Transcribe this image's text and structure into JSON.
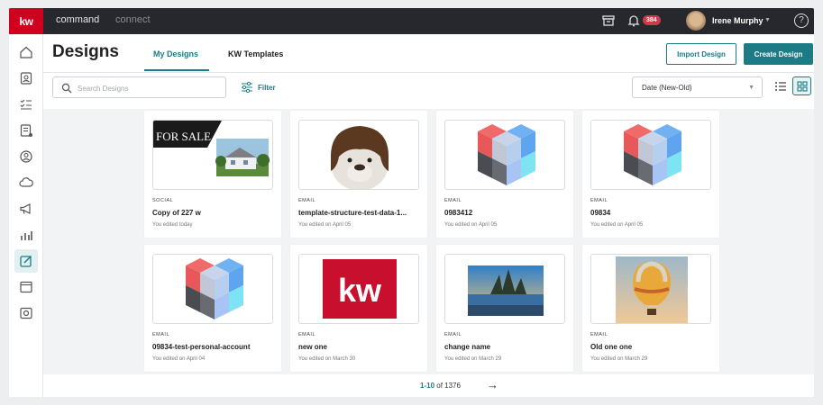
{
  "topbar": {
    "logo": "kw",
    "nav": [
      "command",
      "connect"
    ],
    "notification_count": "384",
    "user_name": "Irene Murphy",
    "help_glyph": "?"
  },
  "sidebar": {
    "items": [
      "home-icon",
      "contacts-icon",
      "tasks-icon",
      "checklist-icon",
      "person-icon",
      "cloud-icon",
      "megaphone-icon",
      "chart-icon",
      "designs-icon",
      "browser-icon",
      "settings-icon"
    ],
    "active": "designs-icon"
  },
  "header": {
    "title": "Designs",
    "tabs": [
      {
        "label": "My Designs",
        "active": true
      },
      {
        "label": "KW Templates",
        "active": false
      }
    ],
    "import_label": "Import Design",
    "create_label": "Create Design"
  },
  "toolbar": {
    "search_placeholder": "Search Designs",
    "filter_label": "Filter",
    "sort_selected": "Date (New-Old)",
    "view_mode": "grid"
  },
  "cards": [
    {
      "type": "SOCIAL",
      "name": "Copy of 227 w",
      "date": "You edited today",
      "thumb": "forsale",
      "thumb_text": "FOR SALE"
    },
    {
      "type": "EMAIL",
      "name": "template-structure-test-data-1...",
      "date": "You edited on April 05",
      "thumb": "dog"
    },
    {
      "type": "EMAIL",
      "name": "0983412",
      "date": "You edited on April 05",
      "thumb": "cube"
    },
    {
      "type": "EMAIL",
      "name": "09834",
      "date": "You edited on April 05",
      "thumb": "cube"
    },
    {
      "type": "EMAIL",
      "name": "09834-test-personal-account",
      "date": "You edited on April 04",
      "thumb": "cube"
    },
    {
      "type": "EMAIL",
      "name": "new one",
      "date": "You edited on March 30",
      "thumb": "kw",
      "thumb_text": "kw"
    },
    {
      "type": "EMAIL",
      "name": "change name",
      "date": "You edited on March 29",
      "thumb": "temple"
    },
    {
      "type": "EMAIL",
      "name": "Old one one",
      "date": "You edited on March 29",
      "thumb": "balloon"
    }
  ],
  "pagination": {
    "range": "1-10",
    "of_label": "of",
    "total": "1376"
  },
  "colors": {
    "accent": "#1d7b86",
    "brand_red": "#ce011f",
    "topbar": "#26282d"
  }
}
